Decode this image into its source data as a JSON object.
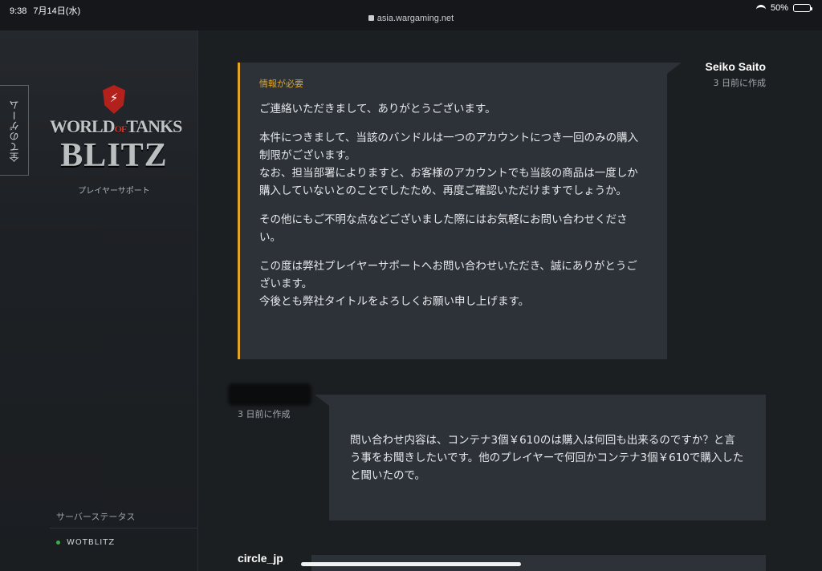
{
  "status": {
    "time": "9:38",
    "date": "7月14日(水)",
    "url": "asia.wargaming.net",
    "battery": "50%"
  },
  "sidebar": {
    "all_games": "全てのゲーム",
    "logo_top_left": "WORLD",
    "logo_of": "OF",
    "logo_top_right": "TANKS",
    "logo_bottom": "BLITZ",
    "support": "プレイヤーサポート",
    "server_title": "サーバーステータス",
    "server_name": "WOTBLITZ",
    "server_status_color": "#3fae49"
  },
  "messages": [
    {
      "author": "Seiko Saito",
      "time": "3 日前に作成",
      "tag": "情報が必要",
      "paragraphs": [
        "ご連絡いただきまして、ありがとうございます。",
        "本件につきまして、当該のバンドルは一つのアカウントにつき一回のみの購入制限がございます。\nなお、担当部署によりますと、お客様のアカウントでも当該の商品は一度しか購入していないとのことでしたため、再度ご確認いただけますでしょうか。",
        "その他にもご不明な点などございました際にはお気軽にお問い合わせください。",
        "この度は弊社プレイヤーサポートへお問い合わせいただき、誠にありがとうございます。\n今後とも弊社タイトルをよろしくお願い申し上げます。"
      ]
    },
    {
      "author": "",
      "time": "3 日前に作成",
      "paragraphs": [
        "問い合わせ内容は、コンテナ3個￥610のは購入は何回も出来るのですか？と言う事をお聞きしたいです。他のプレイヤーで何回かコンテナ3個￥610で購入したと聞いたので。"
      ]
    },
    {
      "author": "circle_jp"
    }
  ],
  "colors": {
    "accent": "#e0a526",
    "bubble": "#2c3238",
    "background": "#1c1f22"
  }
}
